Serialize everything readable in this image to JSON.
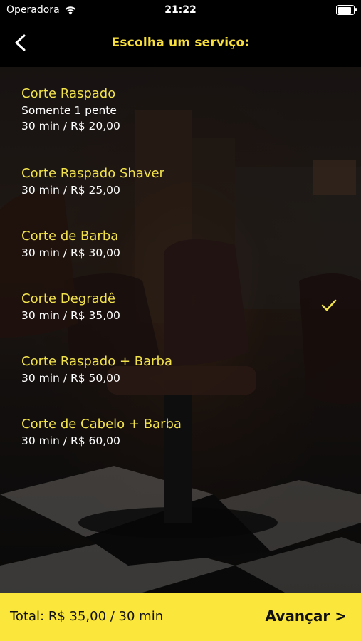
{
  "statusbar": {
    "carrier": "Operadora",
    "time": "21:22",
    "battery_level": 0.9
  },
  "navbar": {
    "title": "Escolha um serviço:"
  },
  "services": [
    {
      "name": "Corte Raspado",
      "note": "Somente 1 pente",
      "info": "30 min / R$ 20,00",
      "selected": false
    },
    {
      "name": "Corte Raspado Shaver",
      "info": "30 min / R$ 25,00",
      "selected": false
    },
    {
      "name": "Corte de Barba",
      "info": "30 min / R$ 30,00",
      "selected": false
    },
    {
      "name": "Corte Degradê",
      "info": "30 min / R$ 35,00",
      "selected": true
    },
    {
      "name": "Corte Raspado + Barba",
      "info": "30 min / R$ 50,00",
      "selected": false
    },
    {
      "name": "Corte de Cabelo + Barba",
      "info": "30 min / R$ 60,00",
      "selected": false
    }
  ],
  "footer": {
    "total": "Total: R$ 35,00 / 30 min",
    "next_label": "Avançar >"
  },
  "colors": {
    "accent": "#f2e24b",
    "footer_bg": "#fbe63b"
  }
}
